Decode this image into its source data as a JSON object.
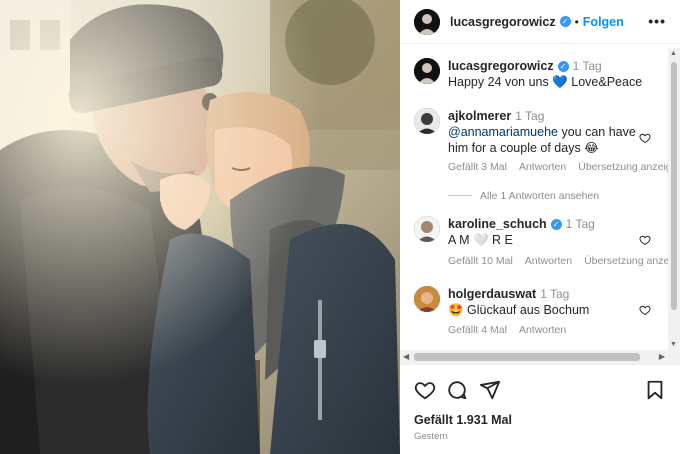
{
  "post": {
    "author": "lucasgregorowicz",
    "follow_label": "Folgen",
    "more_label": "•••",
    "caption": {
      "username": "lucasgregorowicz",
      "time": "1 Tag",
      "text": "Happy 24 von uns 💙 Love&Peace"
    }
  },
  "comments": [
    {
      "username": "ajkolmerer",
      "time": "1 Tag",
      "mention": "@annamariamuehe",
      "text_line1": " you can have",
      "text_line2": "him for a couple of days 😂",
      "likes": "Gefällt 3 Mal",
      "reply": "Antworten",
      "translate": "Übersetzung anzeigen",
      "view_replies": "Alle 1 Antworten ansehen"
    },
    {
      "username": "karoline_schuch",
      "time": "1 Tag",
      "text": "A M 🤍 R E",
      "likes": "Gefällt 10 Mal",
      "reply": "Antworten",
      "translate": "Übersetzung anzeigen"
    },
    {
      "username": "holgerdauswat",
      "time": "1 Tag",
      "text": "🤩 Glückauf aus Bochum",
      "likes": "Gefällt 4 Mal",
      "reply": "Antworten"
    }
  ],
  "footer": {
    "likes": "Gefällt 1.931 Mal",
    "date": "Gestern"
  },
  "icons": {
    "like": "heart-icon",
    "comment": "comment-icon",
    "share": "share-icon",
    "save": "bookmark-icon",
    "verified": "verified-badge-icon"
  },
  "colors": {
    "accent": "#0095f6",
    "verified": "#3897f0",
    "muted": "#8e8e8e"
  }
}
